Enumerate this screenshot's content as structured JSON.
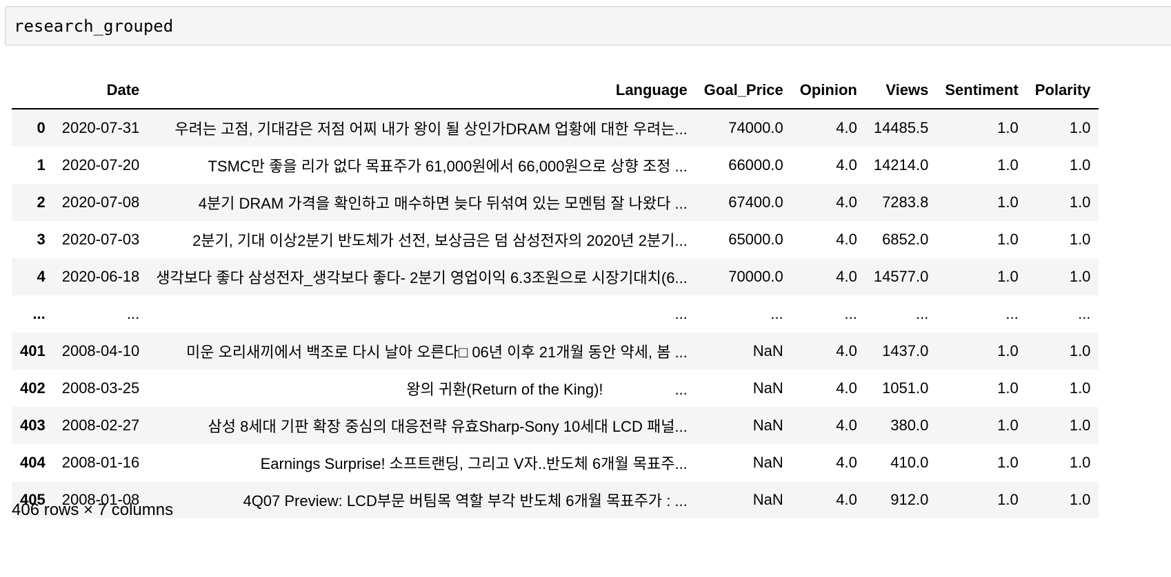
{
  "cell": {
    "code": "research_grouped"
  },
  "table": {
    "columns": [
      "",
      "Date",
      "Language",
      "Goal_Price",
      "Opinion",
      "Views",
      "Sentiment",
      "Polarity"
    ],
    "rows": [
      [
        "0",
        "2020-07-31",
        "우려는 고점, 기대감은 저점 어찌 내가 왕이 될 상인가DRAM 업황에 대한 우려는...",
        "74000.0",
        "4.0",
        "14485.5",
        "1.0",
        "1.0"
      ],
      [
        "1",
        "2020-07-20",
        "TSMC만 좋을 리가 없다 목표주가 61,000원에서 66,000원으로 상향 조정 ...",
        "66000.0",
        "4.0",
        "14214.0",
        "1.0",
        "1.0"
      ],
      [
        "2",
        "2020-07-08",
        "4분기 DRAM 가격을 확인하고 매수하면 늦다 뒤섞여 있는 모멘텀 잘 나왔다 ...",
        "67400.0",
        "4.0",
        "7283.8",
        "1.0",
        "1.0"
      ],
      [
        "3",
        "2020-07-03",
        "2분기, 기대 이상2분기 반도체가 선전, 보상금은 덤  삼성전자의 2020년 2분기...",
        "65000.0",
        "4.0",
        "6852.0",
        "1.0",
        "1.0"
      ],
      [
        "4",
        "2020-06-18",
        "생각보다 좋다 삼성전자_생각보다 좋다- 2분기 영업이익 6.3조원으로 시장기대치(6...",
        "70000.0",
        "4.0",
        "14577.0",
        "1.0",
        "1.0"
      ],
      [
        "...",
        "...",
        "...",
        "...",
        "...",
        "...",
        "...",
        "..."
      ],
      [
        "401",
        "2008-04-10",
        "미운 오리새끼에서 백조로 다시 날아 오른다□ 06년 이후 21개월 동안 약세, 봄 ...",
        "NaN",
        "4.0",
        "1437.0",
        "1.0",
        "1.0"
      ],
      [
        "402",
        "2008-03-25",
        "왕의 귀환(Return of the King)!                 ...",
        "NaN",
        "4.0",
        "1051.0",
        "1.0",
        "1.0"
      ],
      [
        "403",
        "2008-02-27",
        "삼성 8세대 기판 확장 중심의 대응전략 유효Sharp-Sony 10세대 LCD 패널...",
        "NaN",
        "4.0",
        "380.0",
        "1.0",
        "1.0"
      ],
      [
        "404",
        "2008-01-16",
        "Earnings Surprise! 소프트랜딩, 그리고 V자..반도체  6개월 목표주...",
        "NaN",
        "4.0",
        "410.0",
        "1.0",
        "1.0"
      ],
      [
        "405",
        "2008-01-08",
        "4Q07 Preview: LCD부문 버팀목 역할 부각 반도체  6개월 목표주가 : ...",
        "NaN",
        "4.0",
        "912.0",
        "1.0",
        "1.0"
      ]
    ]
  },
  "summary": "406 rows × 7 columns"
}
